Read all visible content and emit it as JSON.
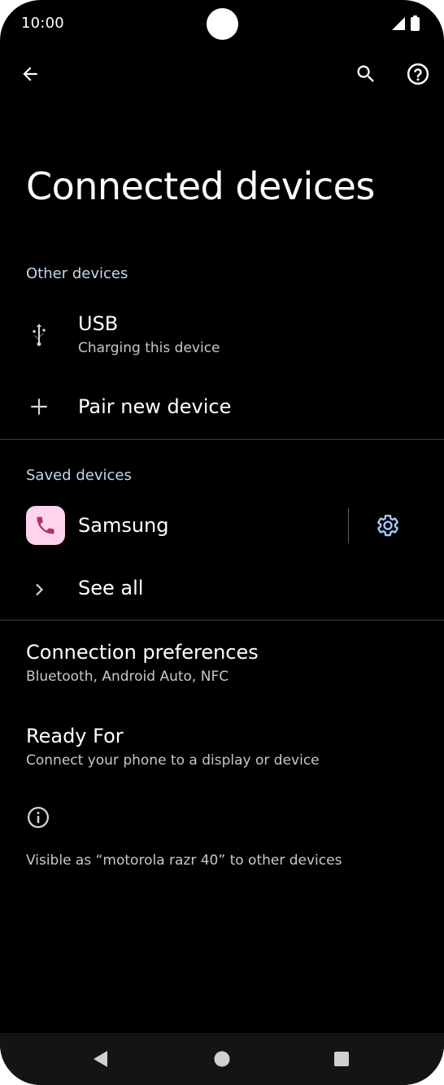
{
  "status_bar": {
    "time": "10:00"
  },
  "app_bar": {
    "back_icon": "arrow-back-icon",
    "search_icon": "search-icon",
    "help_icon": "help-circle-icon"
  },
  "page": {
    "title": "Connected devices"
  },
  "other_devices": {
    "header": "Other devices",
    "usb": {
      "title": "USB",
      "subtitle": "Charging this device",
      "icon": "usb-icon"
    },
    "pair": {
      "title": "Pair new device",
      "icon": "plus-icon"
    }
  },
  "saved_devices": {
    "header": "Saved devices",
    "device": {
      "name": "Samsung",
      "icon": "phone-icon"
    },
    "settings_icon": "gear-icon",
    "see_all": {
      "title": "See all",
      "icon": "chevron-right-icon"
    }
  },
  "preferences": {
    "connection": {
      "title": "Connection preferences",
      "subtitle": "Bluetooth, Android Auto, NFC"
    },
    "ready_for": {
      "title": "Ready For",
      "subtitle": "Connect your phone to a display or device"
    }
  },
  "footer": {
    "info_icon": "info-icon",
    "visible_as": "Visible as “motorola razr 40” to other devices"
  },
  "nav_bar": {
    "back_icon": "nav-back-icon",
    "home_icon": "nav-home-icon",
    "recents_icon": "nav-recents-icon"
  },
  "colors": {
    "background": "#000000",
    "accent": "#a8c7fa",
    "section_header": "#c5d6ee",
    "app_tile": "#ffd4ea",
    "app_tile_glyph": "#b3326e"
  }
}
